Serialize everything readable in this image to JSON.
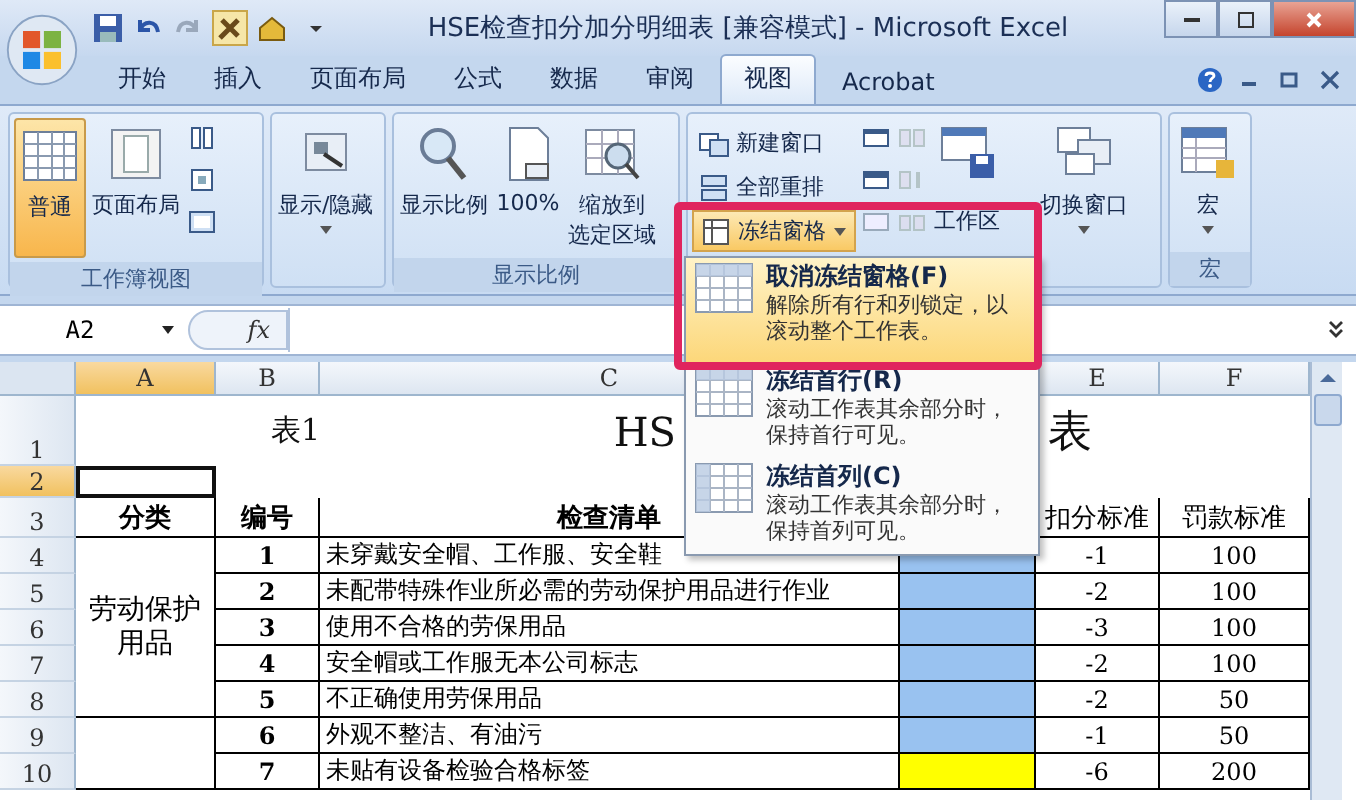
{
  "window": {
    "title": "HSE检查扣分加分明细表 [兼容模式] - Microsoft Excel"
  },
  "ribbon_tabs": [
    {
      "label": "开始",
      "selected": false
    },
    {
      "label": "插入",
      "selected": false
    },
    {
      "label": "页面布局",
      "selected": false
    },
    {
      "label": "公式",
      "selected": false
    },
    {
      "label": "数据",
      "selected": false
    },
    {
      "label": "审阅",
      "selected": false
    },
    {
      "label": "视图",
      "selected": true
    },
    {
      "label": "Acrobat",
      "selected": false
    }
  ],
  "ribbon": {
    "workbook_views": {
      "label": "工作簿视图",
      "normal": {
        "label": "普通",
        "selected": true
      },
      "page_layout": "页面布局"
    },
    "show_hide": {
      "button": "显示/隐藏"
    },
    "zoom": {
      "label": "显示比例",
      "zoom": "显示比例",
      "hundred": "100%",
      "fit_selection": [
        "缩放到",
        "选定区域"
      ]
    },
    "window": {
      "new_window": "新建窗口",
      "arrange_all": "全部重排",
      "freeze_panes": "冻结窗格",
      "save_workspace": "工作区",
      "switch_windows": "切换窗口"
    },
    "macros": {
      "label": "宏",
      "button": "宏"
    }
  },
  "freeze_menu": [
    {
      "title": "取消冻结窗格(F)",
      "description": "解除所有行和列锁定，以滚动整个工作表。",
      "selected": true
    },
    {
      "title": "冻结首行(R)",
      "description": "滚动工作表其余部分时，保持首行可见。",
      "selected": false
    },
    {
      "title": "冻结首列(C)",
      "description": "滚动工作表其余部分时，保持首列可见。",
      "selected": false
    }
  ],
  "formula_bar": {
    "name_box": "A2",
    "function_label": "fx"
  },
  "sheet": {
    "columns": [
      {
        "label": "A",
        "selected": true
      },
      {
        "label": "B",
        "selected": false
      },
      {
        "label": "C",
        "selected": false
      },
      {
        "label": "E",
        "selected": false
      },
      {
        "label": "F",
        "selected": false
      }
    ],
    "row_numbers": [
      {
        "label": "1",
        "selected": false
      },
      {
        "label": "2",
        "selected": true
      },
      {
        "label": "3",
        "selected": false
      },
      {
        "label": "4",
        "selected": false
      },
      {
        "label": "5",
        "selected": false
      },
      {
        "label": "6",
        "selected": false
      },
      {
        "label": "7",
        "selected": false
      },
      {
        "label": "8",
        "selected": false
      },
      {
        "label": "9",
        "selected": false
      },
      {
        "label": "10",
        "selected": false
      }
    ],
    "title_row": {
      "table_label": "表1",
      "title_start": "HS",
      "title_end": "表"
    },
    "header_row": {
      "category": "分类",
      "number": "编号",
      "item": "检查清单",
      "deduction": "扣分标准",
      "fine": "罚款标准"
    },
    "groups": [
      {
        "category": "劳动保护用品",
        "rows": [
          {
            "number": "1",
            "item": "未穿戴安全帽、工作服、安全鞋",
            "color": "#99c2f0",
            "deduction": "-1",
            "fine": "100"
          },
          {
            "number": "2",
            "item": "未配带特殊作业所必需的劳动保护用品进行作业",
            "color": "#99c2f0",
            "deduction": "-2",
            "fine": "100"
          },
          {
            "number": "3",
            "item": "使用不合格的劳保用品",
            "color": "#99c2f0",
            "deduction": "-3",
            "fine": "100"
          },
          {
            "number": "4",
            "item": "安全帽或工作服无本公司标志",
            "color": "#99c2f0",
            "deduction": "-2",
            "fine": "100"
          },
          {
            "number": "5",
            "item": "不正确使用劳保用品",
            "color": "#99c2f0",
            "deduction": "-2",
            "fine": "50"
          }
        ]
      },
      {
        "rows": [
          {
            "number": "6",
            "item": "外观不整洁、有油污",
            "color": "#99c2f0",
            "deduction": "-1",
            "fine": "50"
          },
          {
            "number": "7",
            "item": "未贴有设备检验合格标签",
            "color": "#ffff00",
            "deduction": "-6",
            "fine": "200"
          }
        ]
      }
    ]
  }
}
